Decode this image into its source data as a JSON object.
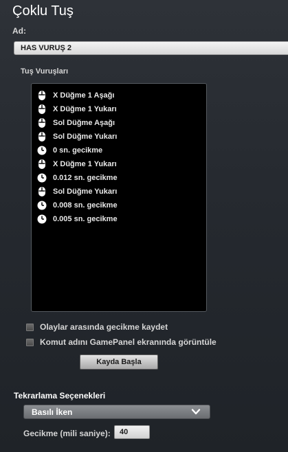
{
  "title": "Çoklu Tuş",
  "name_label": "Ad:",
  "name_value": "HAS VURUŞ 2",
  "keystrokes_label": "Tuş Vuruşları",
  "keystrokes": [
    {
      "icon": "mouse-icon",
      "text": "X Düğme 1 Aşağı"
    },
    {
      "icon": "mouse-icon",
      "text": "X Düğme 1 Yukarı"
    },
    {
      "icon": "mouse-icon",
      "text": "Sol Düğme Aşağı"
    },
    {
      "icon": "mouse-icon",
      "text": "Sol Düğme Yukarı"
    },
    {
      "icon": "clock-icon",
      "text": "0 sn. gecikme"
    },
    {
      "icon": "mouse-icon",
      "text": "X Düğme 1 Yukarı"
    },
    {
      "icon": "clock-icon",
      "text": "0.012 sn. gecikme"
    },
    {
      "icon": "mouse-icon",
      "text": "Sol Düğme Yukarı"
    },
    {
      "icon": "clock-icon",
      "text": "0.008 sn. gecikme"
    },
    {
      "icon": "clock-icon",
      "text": "0.005 sn. gecikme"
    }
  ],
  "options": {
    "record_delays": {
      "label": "Olaylar arasında gecikme kaydet",
      "checked": false
    },
    "show_name": {
      "label": "Komut adını GamePanel ekranında görüntüle",
      "checked": false
    }
  },
  "record_button": "Kayda Başla",
  "repeat": {
    "label": "Tekrarlama Seçenekleri",
    "selected": "Basılı İken",
    "delay_label": "Gecikme (mili saniye):",
    "delay_value": "40"
  }
}
